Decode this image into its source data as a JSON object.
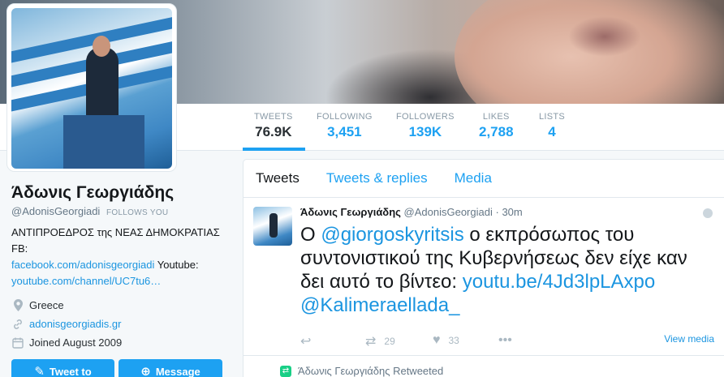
{
  "profile": {
    "name": "Άδωνις Γεωργιάδης",
    "handle": "@AdonisGeorgiadi",
    "follows_you": "FOLLOWS YOU",
    "bio_text": "ΑΝΤΙΠΡΟΕΔΡΟΣ της ΝΕΑΣ ΔΗΜΟΚΡΑΤΙΑΣ FB:",
    "bio_link1": "facebook.com/adonisgeorgiadi",
    "bio_youtube_label": "Youtube:",
    "bio_link2": "youtube.com/channel/UC7tu6…",
    "location": "Greece",
    "website": "adonisgeorgiadis.gr",
    "joined": "Joined August 2009"
  },
  "stats": [
    {
      "label": "TWEETS",
      "value": "76.9K"
    },
    {
      "label": "FOLLOWING",
      "value": "3,451"
    },
    {
      "label": "FOLLOWERS",
      "value": "139K"
    },
    {
      "label": "LIKES",
      "value": "2,788"
    },
    {
      "label": "LISTS",
      "value": "4"
    }
  ],
  "buttons": {
    "tweet_to": "Tweet to",
    "message": "Message"
  },
  "tabs": [
    "Tweets",
    "Tweets & replies",
    "Media"
  ],
  "tweet": {
    "name": "Άδωνις Γεωργιάδης",
    "handle": "@AdonisGeorgiadi",
    "dot": "·",
    "time": "30m",
    "mention": "@giorgoskyritsis",
    "text_1": "Ο ",
    "text_2": " ο εκπρόσωπος του συντονιστικού της Κυβερνήσεως δεν είχε καν δει αυτό το βίντεο: ",
    "link": "youtu.be/4Jd3lpLAxpo",
    "mention2": "@Kalimeraellada_",
    "retweet_count": "29",
    "like_count": "33",
    "view_media": "View media"
  },
  "retweeted": {
    "text": "Άδωνις Γεωργιάδης Retweeted"
  },
  "colors": {
    "accent": "#1da1f2",
    "retweet": "#19cf86"
  }
}
